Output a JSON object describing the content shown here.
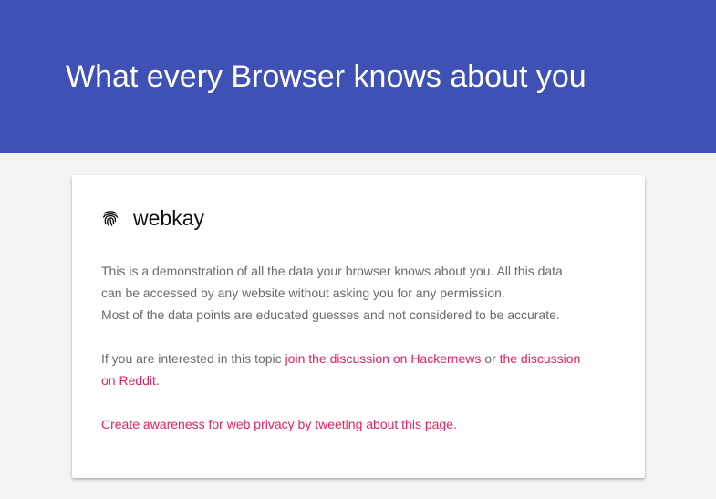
{
  "header": {
    "title": "What every Browser knows about you"
  },
  "brand": {
    "icon": "fingerprint-icon",
    "name": "webkay"
  },
  "intro": {
    "line1": "This is a demonstration of all the data your browser knows about you. All this data",
    "line2": "can be accessed by any website without asking you for any permission.",
    "line3": "Most of the data points are educated guesses and not considered to be accurate."
  },
  "discussion": {
    "prefix": "If you are interested in this topic ",
    "hackernews_link": "join the discussion on Hackernews",
    "middle": " or ",
    "reddit_link_part1": "the discussion",
    "reddit_link_part2": "on Reddit",
    "suffix": "."
  },
  "awareness": {
    "link": "Create awareness for web privacy by tweeting about this page."
  },
  "colors": {
    "header_bg": "#3f51b5",
    "page_bg": "#f4f4f4",
    "link": "#e91e63",
    "body_text": "#6b6b6b"
  }
}
